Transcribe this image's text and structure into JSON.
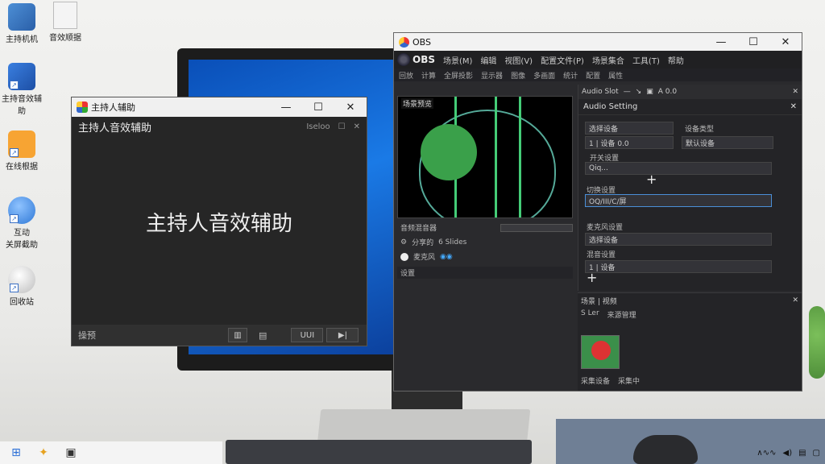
{
  "desktop_icons": [
    {
      "label": "主持机机"
    },
    {
      "label": "主持音效辅助"
    },
    {
      "label": "在线根据"
    },
    {
      "label": "互动\n关屏截助"
    },
    {
      "label": "回收站"
    }
  ],
  "desktop_icon_top": {
    "label": "音效顺据"
  },
  "helper_window": {
    "title": "主持人辅助",
    "header": "主持人音效辅助",
    "header_right": "Iseloo",
    "main_text": "主持人音效辅助",
    "footer_left": "操预",
    "footer_btn": "UUI"
  },
  "obs_window": {
    "title": "OBS",
    "menu": [
      "OBS",
      "场景(M)",
      "编辑",
      "视图(V)",
      "配置文件(P)",
      "场景集合",
      "工具(T)",
      "帮助"
    ],
    "toolbar": [
      "回放",
      "计算",
      "全屏投影",
      "显示器",
      "图像",
      "多画面",
      "统计",
      "配置",
      "属性"
    ],
    "preview_label": "场景预览",
    "rows": [
      "音频混音器",
      "分享的",
      "6 Slides",
      "麦克风",
      "设置"
    ],
    "dock_title": "Audio Slot",
    "dock_value": "A 0.0",
    "settings_title": "Audio Setting",
    "fields": [
      "选择设备",
      "选择设备",
      "选择设备",
      "选择设备"
    ],
    "labels": [
      "设备类型",
      "开关设置",
      "切换设置",
      "麦克风设置",
      "混音设置"
    ],
    "field_values": [
      "1 | 设备 0.0",
      "默认设备",
      "Qiq...",
      "OQ/III/C/屏",
      "1 | 设备"
    ],
    "sources_title": "场景 | 视频",
    "sources_tabs": [
      "S Ler",
      "来源管理"
    ],
    "sources_footer": [
      "采集设备",
      "采集中"
    ]
  },
  "colors": {
    "accent": "#3a6fc4",
    "obs_bg": "#2a2a2d",
    "helper_bg": "#262626"
  }
}
